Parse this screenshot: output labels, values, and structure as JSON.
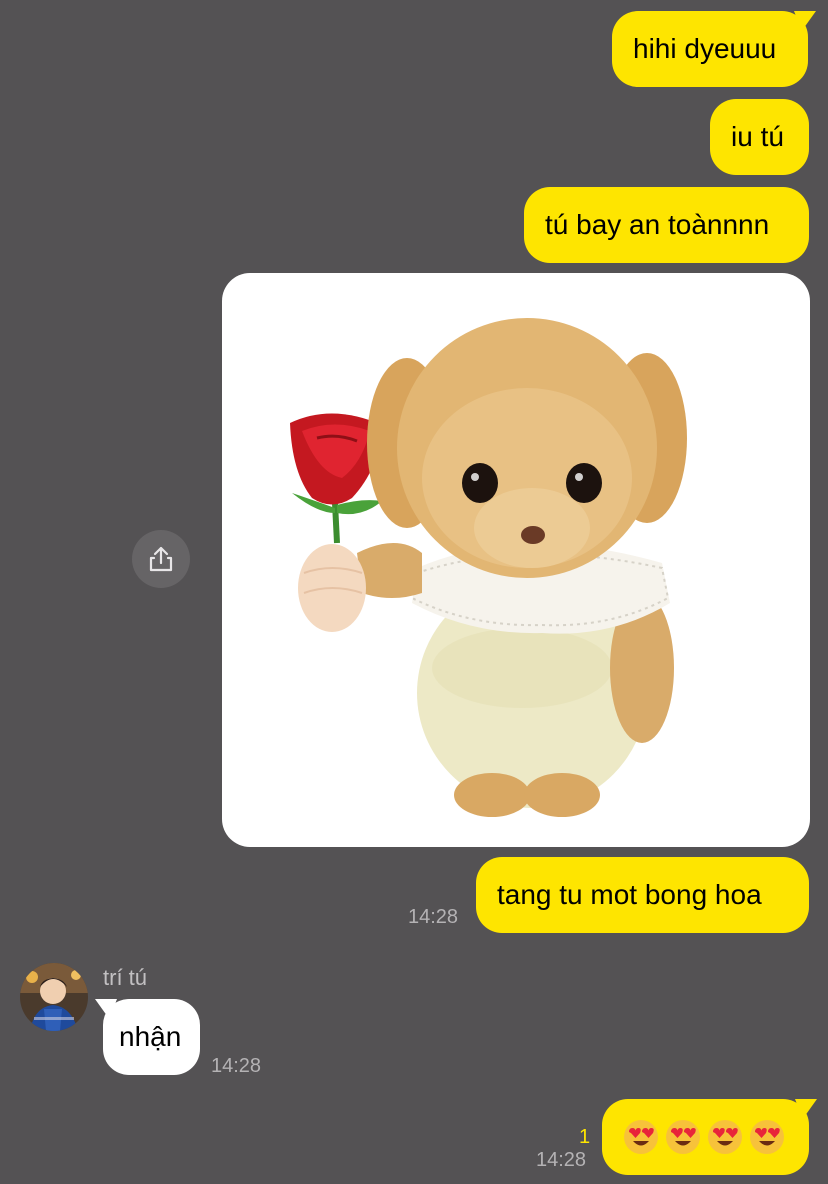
{
  "messages": {
    "m1": "hihi dyeuuu",
    "m2": "iu tú",
    "m3": "tú bay an toànnnn",
    "m4": "tang tu mot bong hoa",
    "m4_time": "14:28",
    "reply_sender": "trí tú",
    "reply_text": "nhận",
    "reply_time": "14:28",
    "m5_unread": "1",
    "m5_time": "14:28",
    "m5_emojis": [
      "heart-eyes",
      "heart-eyes",
      "heart-eyes",
      "heart-eyes"
    ]
  },
  "colors": {
    "background": "#545254",
    "outgoing_bubble": "#fee500",
    "incoming_bubble": "#ffffff",
    "timestamp": "#b4b2b4"
  },
  "icons": {
    "share": "share-icon",
    "emoji": "heart-eyes-emoji-icon"
  }
}
